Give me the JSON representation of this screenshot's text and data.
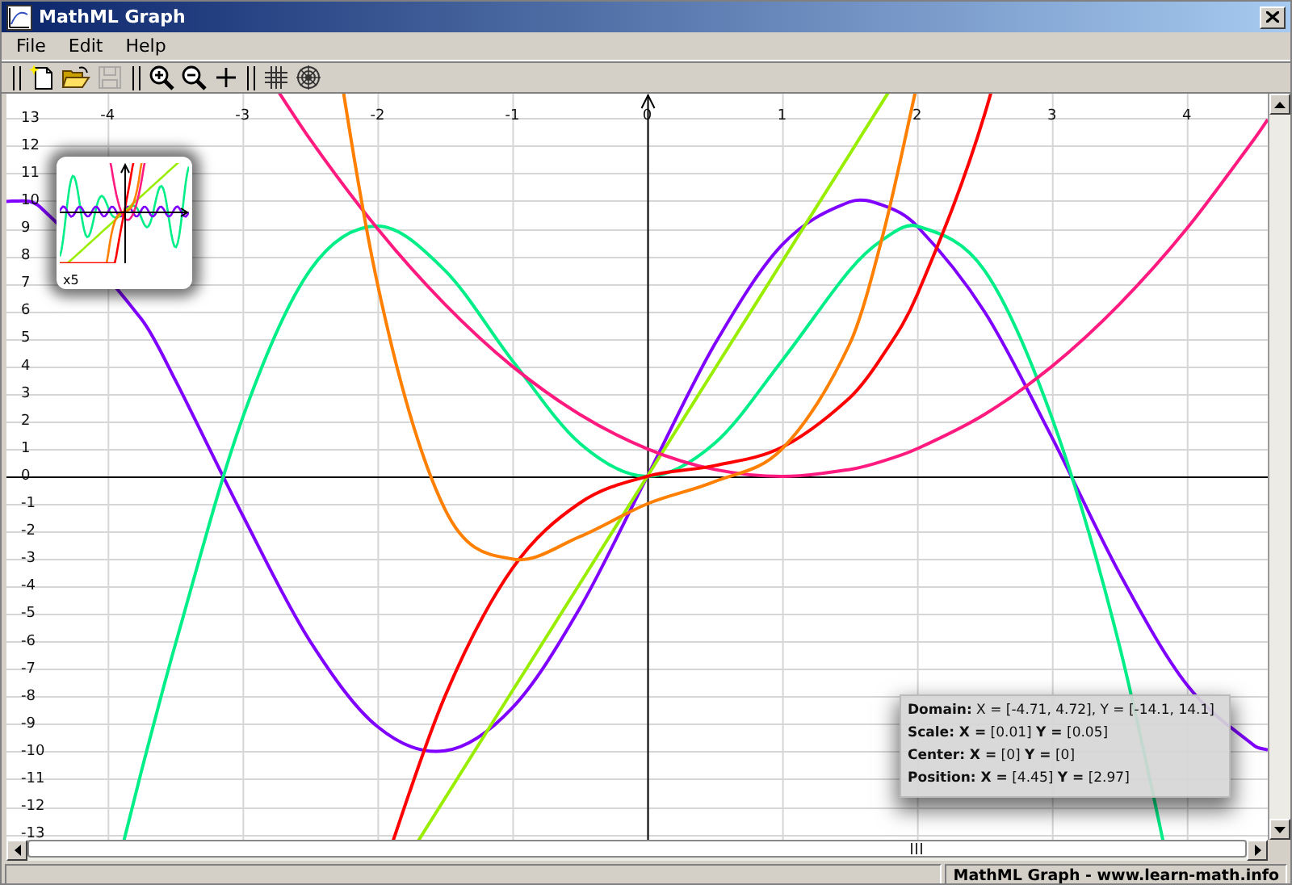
{
  "window": {
    "title": "MathML Graph"
  },
  "menu": [
    "File",
    "Edit",
    "Help"
  ],
  "toolbar": {
    "groups": [
      {
        "items": [
          {
            "kind": "new",
            "disabled": false
          },
          {
            "kind": "open",
            "disabled": false
          },
          {
            "kind": "save",
            "disabled": true
          }
        ]
      },
      {
        "items": [
          {
            "kind": "zoom_in",
            "disabled": false
          },
          {
            "kind": "zoom_out",
            "disabled": false
          },
          {
            "kind": "crosshair",
            "disabled": false
          }
        ]
      },
      {
        "items": [
          {
            "kind": "grid",
            "disabled": false
          },
          {
            "kind": "polar_grid",
            "disabled": false
          }
        ]
      }
    ]
  },
  "graph": {
    "chart_data": {
      "type": "line",
      "x": [
        -4.7,
        -4.5,
        -3.75,
        -3.5,
        -3,
        -2.5,
        -2,
        -1.5,
        -1,
        -0.5,
        0,
        0.5,
        1,
        1.5,
        1.75,
        2,
        2.5,
        3,
        3.5,
        4,
        4.5,
        4.6
      ],
      "series": [
        {
          "color": "#8000ff",
          "values": [
            10.0,
            9.78,
            5.72,
            3.51,
            -1.41,
            -5.98,
            -9.09,
            -9.97,
            -8.41,
            -4.79,
            0,
            4.79,
            8.41,
            9.97,
            9.84,
            9.09,
            5.98,
            1.41,
            -3.51,
            -7.57,
            -9.78,
            -9.94
          ]
        },
        {
          "color": "#00ee88",
          "values": [
            null,
            null,
            -10.72,
            -6.14,
            2.12,
            7.48,
            9.09,
            7.48,
            4.21,
            1.2,
            0,
            1.2,
            4.21,
            7.48,
            8.61,
            9.09,
            7.48,
            2.12,
            -6.14,
            null,
            null,
            null
          ]
        },
        {
          "color": "#99ee00",
          "values": [
            null,
            null,
            null,
            null,
            null,
            null,
            null,
            -11.7,
            -7.8,
            -3.9,
            0,
            3.9,
            7.8,
            11.7,
            13.65,
            null,
            null,
            null,
            null,
            null,
            null,
            null
          ]
        },
        {
          "color": "#ff1a80",
          "values": [
            null,
            null,
            null,
            null,
            null,
            12.25,
            9,
            6.25,
            4,
            2.25,
            1,
            0.25,
            0,
            0.25,
            0.56,
            1,
            2.25,
            4,
            6.25,
            9,
            12.25,
            12.96
          ]
        },
        {
          "color": "#ff0000",
          "values": [
            null,
            null,
            null,
            null,
            null,
            null,
            null,
            -7.99,
            -3.35,
            -0.97,
            0,
            0.39,
            1.06,
            2.85,
            4.42,
            6.58,
            13.13,
            null,
            null,
            null,
            null,
            null
          ]
        },
        {
          "color": "#ff8000",
          "values": [
            null,
            null,
            null,
            null,
            null,
            null,
            7,
            -1.19,
            -3,
            -2.19,
            -1,
            -0.19,
            1,
            4.81,
            8.82,
            null,
            null,
            null,
            null,
            null,
            null,
            null
          ]
        }
      ],
      "xlim": [
        -4.75,
        4.6
      ],
      "ylim": [
        -13.2,
        13.9
      ],
      "grid": true,
      "xticks": [
        -4,
        -3,
        -2,
        -1,
        0,
        1,
        2,
        3,
        4
      ],
      "yticks": [
        -13,
        -12,
        -11,
        -10,
        -9,
        -8,
        -7,
        -6,
        -5,
        -4,
        -3,
        -2,
        -1,
        0,
        1,
        2,
        3,
        4,
        5,
        6,
        7,
        8,
        9,
        10,
        11,
        12,
        13
      ]
    },
    "thumbnail": {
      "label": "x5"
    },
    "info": {
      "lines": [
        "**Domain:** X = [-4.71, 4.72], Y = [-14.1, 14.1]",
        "**Scale: X =** [0.01]   **Y =** [0.05]",
        "**Center: X =** [0]   **Y =** [0]",
        "**Position: X =** [4.45]   **Y =** [2.97]"
      ]
    }
  },
  "status_bar": {
    "text": "MathML Graph - www.learn-math.info"
  }
}
